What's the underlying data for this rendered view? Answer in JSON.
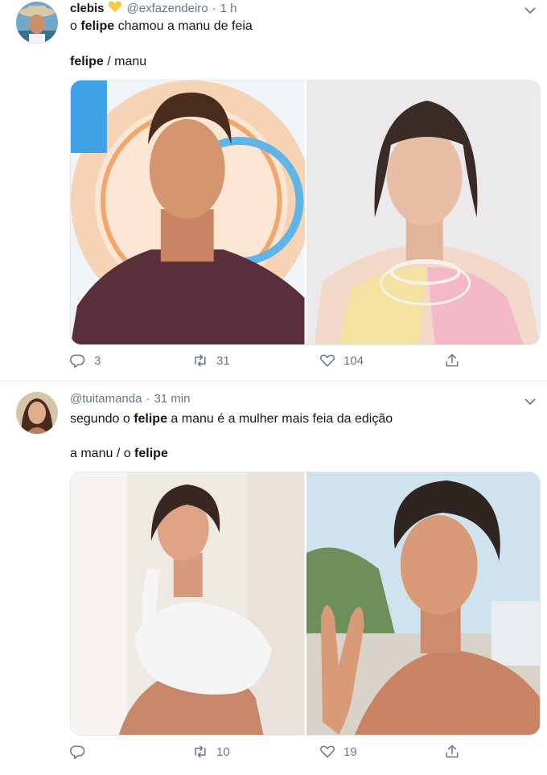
{
  "tweets": [
    {
      "display_name": "clebis",
      "handle": "@exfazendeiro",
      "separator": "·",
      "time": "1 h",
      "line1": {
        "pre": "o ",
        "bold": "felipe",
        "post": " chamou a manu de feia"
      },
      "line2": {
        "pre": "",
        "bold": "felipe",
        "post": " / manu"
      },
      "replies": "3",
      "retweets": "31",
      "likes": "104"
    },
    {
      "display_name": "",
      "handle": "@tuitamanda",
      "separator": "·",
      "time": "31 min",
      "line1": {
        "pre": "segundo o ",
        "bold": "felipe",
        "post": " a manu é a mulher mais feia da edição"
      },
      "line2": {
        "pre": "a manu / o ",
        "bold": "felipe",
        "post": ""
      },
      "replies": "",
      "retweets": "10",
      "likes": "19"
    }
  ],
  "colors": {
    "text": "#14171a",
    "secondary": "#657786",
    "divider": "#e1e8ed",
    "badge": "#f7c948"
  },
  "icons": [
    "avatar-cowboy",
    "yellow-heart-icon",
    "chevron-down-icon",
    "reply-icon",
    "retweet-icon",
    "like-icon",
    "share-icon"
  ]
}
